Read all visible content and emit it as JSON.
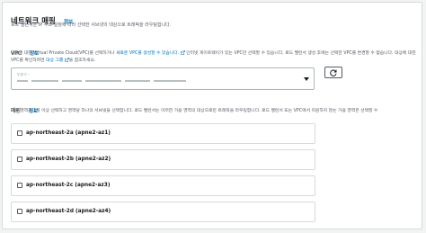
{
  "section": {
    "title": "네트워크 매핑",
    "info": "정보",
    "description": "로드 밸런서는 IP 주소 설정에 따라 선택한 서브넷의 대상으로 트래픽을 라우팅합니다."
  },
  "vpc": {
    "label": "VPC",
    "info": "정보",
    "desc_part1": "대상에 대한 Virtual Private Cloud(VPC)를 선택하거나 ",
    "desc_link1": "새로운 VPC를 생성할 수 있습니다.",
    "desc_part2": " 인터넷 게이트웨이가 있는 VPC만 선택할 수 있습니다. 로드 밸런서 생성 후에는 선택한 VPC를 변경할 수 없습니다. 대상에 대한 VPC를 확인하려면 ",
    "desc_link2": "대상 그룹",
    "desc_part3": "을 참조하세요.",
    "select_value_top": "vpc-",
    "refresh_label": "새로 고침"
  },
  "mapping": {
    "label": "매핑",
    "info": "정보",
    "description": "가용 영역을 2개 이상 선택하고 영역당 하나의 서브넷을 선택합니다. 로드 밸런서는 이러한 가용 영역의 대상으로만 트래픽을 라우팅합니다. 로드 밸런서 또는 VPC에서 지원하지 않는 가용 영역은 선택할 수"
  },
  "zones": [
    {
      "label": "ap-northeast-2a (apne2-az1)",
      "checked": false
    },
    {
      "label": "ap-northeast-2b (apne2-az2)",
      "checked": false
    },
    {
      "label": "ap-northeast-2c (apne2-az3)",
      "checked": false
    },
    {
      "label": "ap-northeast-2d (apne2-az4)",
      "checked": false
    }
  ],
  "colors": {
    "link": "#0073bb",
    "text": "#16191f",
    "muted": "#545b64",
    "border": "#d5dbdb"
  }
}
